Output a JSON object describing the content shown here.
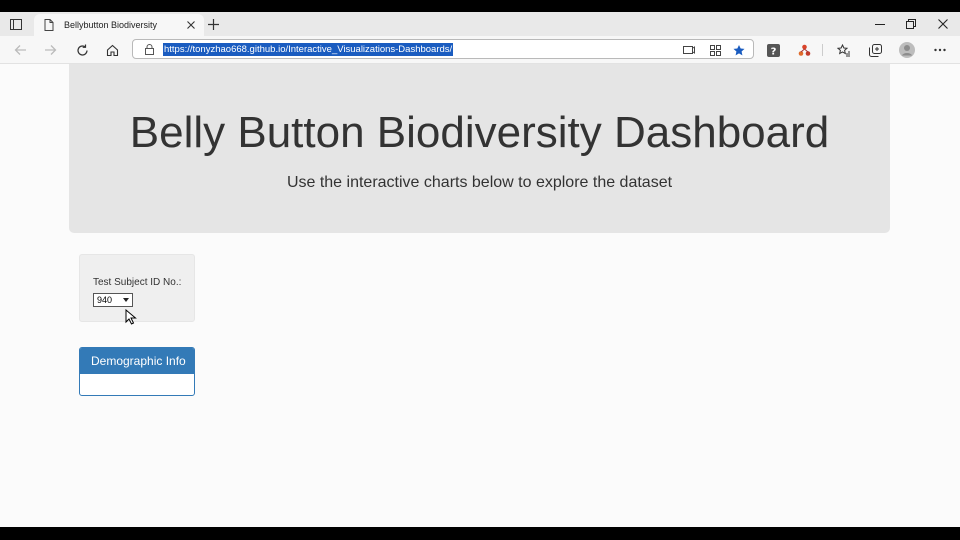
{
  "browser": {
    "tab_title": "Bellybutton Biodiversity",
    "url": "https://tonyzhao668.github.io/Interactive_Visualizations-Dashboards/",
    "icons": {
      "tab_actions": "tab-actions-icon",
      "page": "page-icon",
      "tab_close": "close-icon",
      "new_tab": "plus-icon",
      "minimize": "minimize-icon",
      "restore": "restore-icon",
      "close_window": "close-icon",
      "back": "back-arrow-icon",
      "forward": "forward-arrow-icon",
      "refresh": "refresh-icon",
      "home": "home-icon",
      "lock": "lock-icon",
      "read_aloud": "read-mode-icon",
      "apps": "apps-icon",
      "favorite": "star-icon",
      "extension_1": "extension-icon",
      "extension_2": "extension-icon",
      "favorites": "favorites-icon",
      "collections": "collections-icon",
      "profile": "profile-icon",
      "more": "more-icon"
    },
    "accent_color": "#1a5cc0"
  },
  "page": {
    "title": "Belly Button Biodiversity Dashboard",
    "subtitle": "Use the interactive charts below to explore the dataset",
    "selector": {
      "label": "Test Subject ID No.:",
      "selected_value": "940"
    },
    "demographic_panel": {
      "heading": "Demographic Info",
      "color": "#337ab7"
    }
  }
}
